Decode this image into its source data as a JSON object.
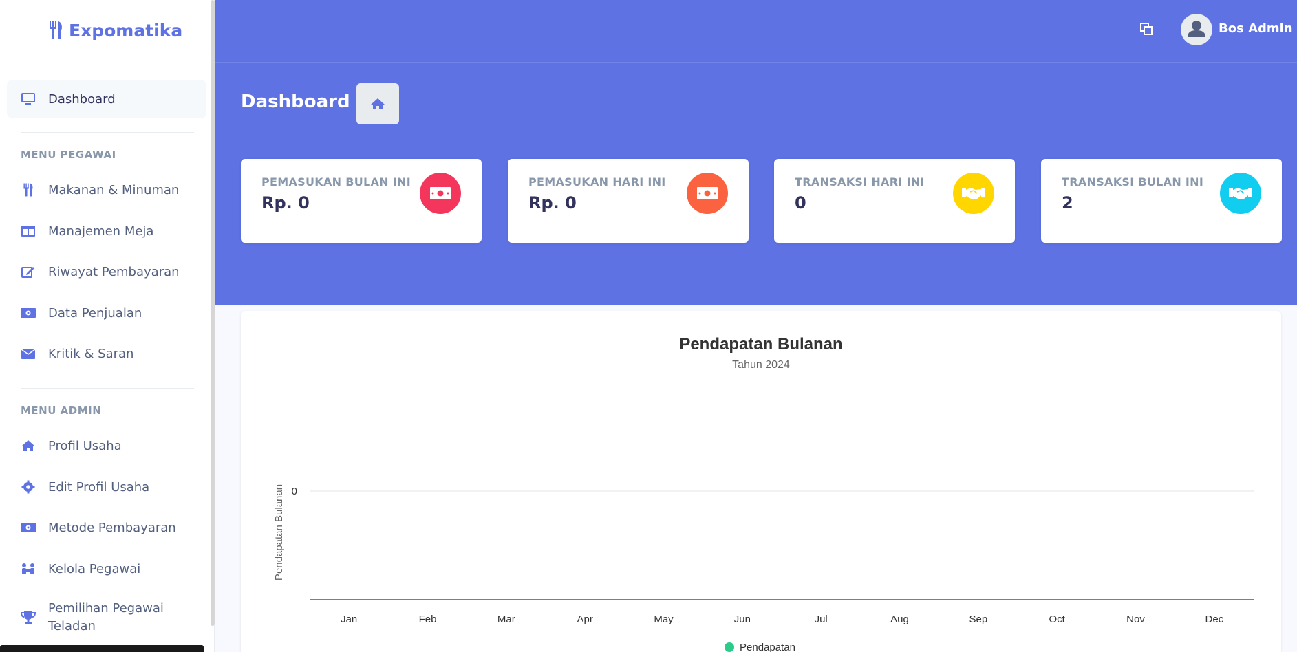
{
  "brand": {
    "name": "Expomatika",
    "icon": "utensils-icon"
  },
  "sidebar": {
    "items_main": [
      {
        "label": "Dashboard",
        "icon": "monitor-icon",
        "active": true
      }
    ],
    "section_pegawai": "MENU PEGAWAI",
    "items_pegawai": [
      {
        "label": "Makanan & Minuman",
        "icon": "utensils-icon"
      },
      {
        "label": "Manajemen Meja",
        "icon": "table-icon"
      },
      {
        "label": "Riwayat Pembayaran",
        "icon": "edit-icon"
      },
      {
        "label": "Data Penjualan",
        "icon": "money-icon"
      },
      {
        "label": "Kritik & Saran",
        "icon": "envelope-icon"
      }
    ],
    "section_admin": "MENU ADMIN",
    "items_admin": [
      {
        "label": "Profil Usaha",
        "icon": "home-icon"
      },
      {
        "label": "Edit Profil Usaha",
        "icon": "gear-icon"
      },
      {
        "label": "Metode Pembayaran",
        "icon": "money-icon"
      },
      {
        "label": "Kelola Pegawai",
        "icon": "users-icon"
      },
      {
        "label": "Pemilihan Pegawai Teladan",
        "icon": "trophy-icon"
      }
    ]
  },
  "topbar": {
    "user_name": "Bos Admin",
    "icon": "windows-icon"
  },
  "page": {
    "title": "Dashboard"
  },
  "stats": [
    {
      "title": "PEMASUKAN BULAN INI",
      "value": "Rp. 0",
      "icon": "money-icon",
      "color": "#f5365c"
    },
    {
      "title": "PEMASUKAN HARI INI",
      "value": "Rp. 0",
      "icon": "money-icon",
      "color": "#fb6340"
    },
    {
      "title": "TRANSAKSI HARI INI",
      "value": "0",
      "icon": "handshake-icon",
      "color": "#ffd600"
    },
    {
      "title": "TRANSAKSI BULAN INI",
      "value": "2",
      "icon": "handshake-icon",
      "color": "#11cdef"
    }
  ],
  "chart_data": {
    "type": "line",
    "title": "Pendapatan Bulanan",
    "subtitle": "Tahun 2024",
    "ylabel": "Pendapatan Bulanan",
    "xlabel": "",
    "categories": [
      "Jan",
      "Feb",
      "Mar",
      "Apr",
      "May",
      "Jun",
      "Jul",
      "Aug",
      "Sep",
      "Oct",
      "Nov",
      "Dec"
    ],
    "series": [
      {
        "name": "Pendapatan",
        "values": [],
        "color": "#2ccb8a"
      }
    ],
    "yticks": [
      "0"
    ],
    "legend": "bottom",
    "grid": true
  }
}
